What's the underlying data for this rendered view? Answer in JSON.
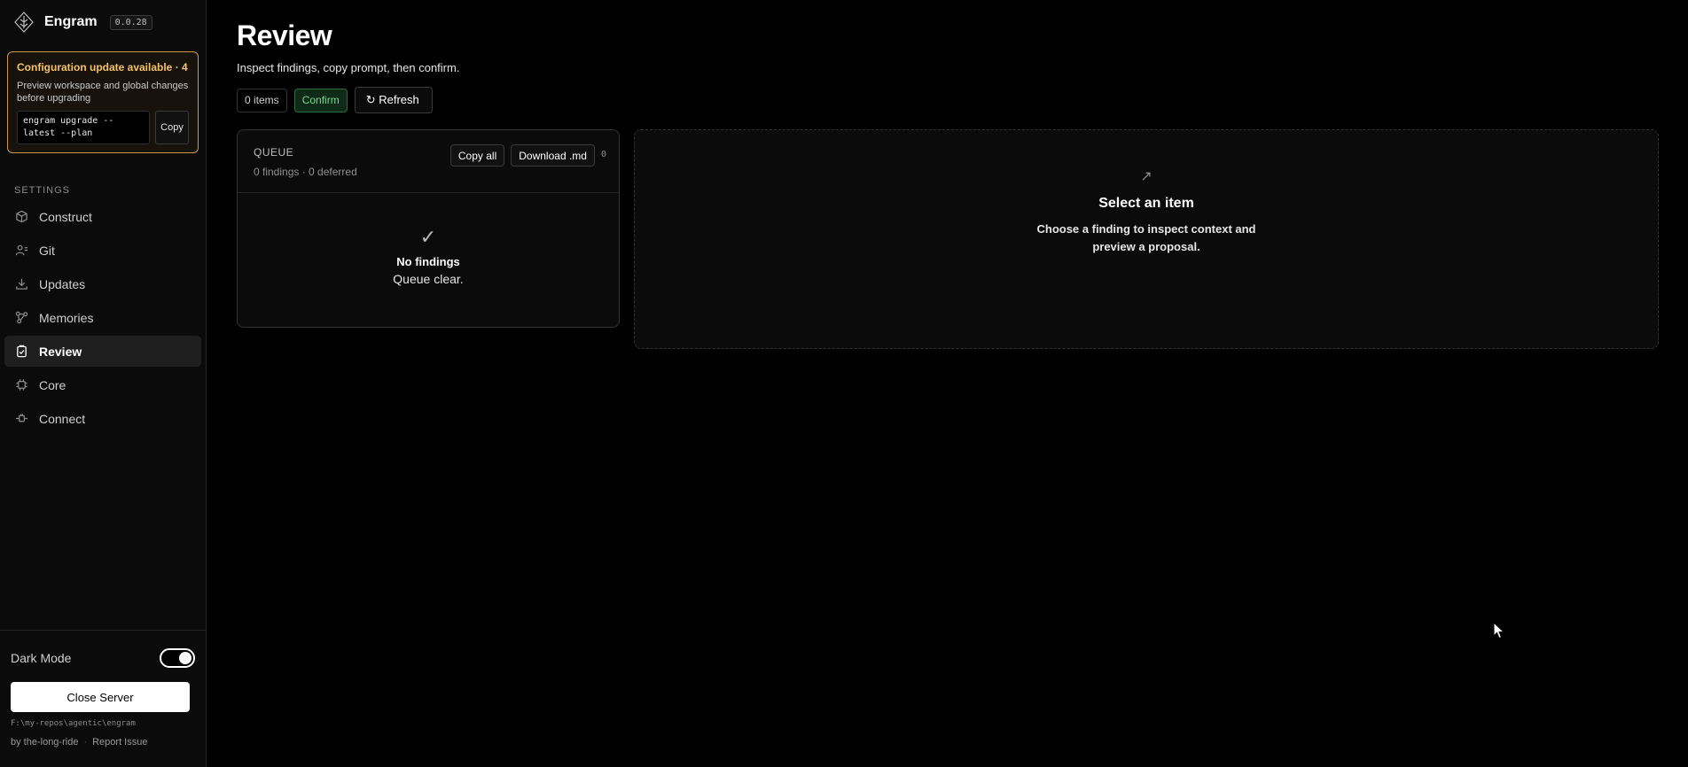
{
  "brand": {
    "name": "Engram",
    "version": "0.0.28"
  },
  "update_card": {
    "title": "Configuration update available · 4",
    "description": "Preview workspace and global changes before upgrading",
    "command": "engram upgrade --latest --plan",
    "copy_label": "Copy"
  },
  "sidebar": {
    "section_label": "SETTINGS",
    "items": [
      {
        "label": "Construct",
        "icon": "cube-icon",
        "active": false
      },
      {
        "label": "Git",
        "icon": "git-user-icon",
        "active": false
      },
      {
        "label": "Updates",
        "icon": "download-icon",
        "active": false
      },
      {
        "label": "Memories",
        "icon": "graph-nodes-icon",
        "active": false
      },
      {
        "label": "Review",
        "icon": "clipboard-check-icon",
        "active": true
      },
      {
        "label": "Core",
        "icon": "chip-icon",
        "active": false
      },
      {
        "label": "Connect",
        "icon": "plug-icon",
        "active": false
      }
    ],
    "dark_mode_label": "Dark Mode",
    "dark_mode_on": true,
    "close_server_label": "Close Server",
    "path": "F:\\my-repos\\agentic\\engram",
    "author": "by the-long-ride",
    "separator": "·",
    "report_issue": "Report Issue"
  },
  "main": {
    "title": "Review",
    "subtitle": "Inspect findings, copy prompt, then confirm.",
    "items_count": "0 items",
    "confirm_label": "Confirm",
    "refresh_label": "↻ Refresh",
    "queue": {
      "title": "QUEUE",
      "meta": "0 findings · 0 deferred",
      "copy_all_label": "Copy all",
      "download_label": "Download .md",
      "count": "0",
      "empty_icon": "✓",
      "empty_title": "No findings",
      "empty_subtitle": "Queue clear."
    },
    "detail": {
      "icon": "↗",
      "title": "Select an item",
      "description": "Choose a finding to inspect context and preview a proposal."
    }
  },
  "colors": {
    "accent_warning": "#f4c26a",
    "accent_success": "#7ad88f",
    "background": "#000000",
    "sidebar_bg": "#0b0b0b"
  }
}
